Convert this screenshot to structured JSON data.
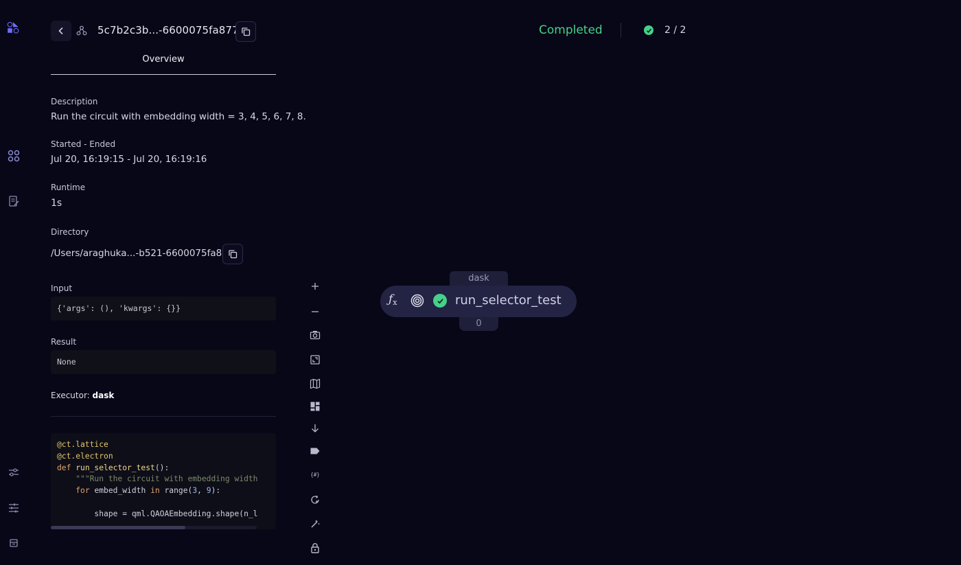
{
  "header": {
    "dispatch_id": "5c7b2c3b...-6600075fa877",
    "tab_overview": "Overview"
  },
  "details": {
    "description_label": "Description",
    "description": "Run the circuit with embedding width = 3, 4, 5, 6, 7, 8.",
    "started_ended_label": "Started - Ended",
    "started_ended": "Jul 20, 16:19:15 - Jul 20, 16:19:16",
    "runtime_label": "Runtime",
    "runtime": "1s",
    "directory_label": "Directory",
    "directory": "/Users/araghuka...-b521-6600075fa877",
    "input_label": "Input",
    "input": "{'args': (), 'kwargs': {}}",
    "result_label": "Result",
    "result": "None",
    "executor_label": "Executor:",
    "executor": "dask"
  },
  "code": {
    "line1": "@ct.lattice",
    "line2": "@ct.electron",
    "line3_kw": "def",
    "line3_fn": "run_selector_test",
    "line3_rest": "():",
    "line4_str": "\"\"\"Run the circuit with embedding width",
    "line5_kw1": "for",
    "line5_mid": "embed_width",
    "line5_kw2": "in",
    "line5_fn": "range(",
    "line5_n1": "3",
    "line5_sep": ",",
    "line5_n2": "9",
    "line5_end": "):",
    "line7": "shape = qml.QAOAEmbedding.shape(n_l"
  },
  "status": {
    "state": "Completed",
    "count": "2 / 2",
    "color": "#46d08a"
  },
  "graph": {
    "node_executor": "dask",
    "node_name": "run_selector_test",
    "node_id": "0",
    "node_fx": "fx"
  },
  "icons": {
    "rail": [
      "logo-icon",
      "lattices-icon",
      "logs-icon",
      "settings-icon",
      "preferences-icon",
      "layout-icon"
    ],
    "toolbar": [
      "zoom-in-icon",
      "zoom-out-icon",
      "screenshot-icon",
      "fit-view-icon",
      "minimap-icon",
      "layout-icon",
      "download-icon",
      "labels-icon",
      "params-icon",
      "reload-icon",
      "highlight-icon",
      "lock-icon"
    ]
  }
}
